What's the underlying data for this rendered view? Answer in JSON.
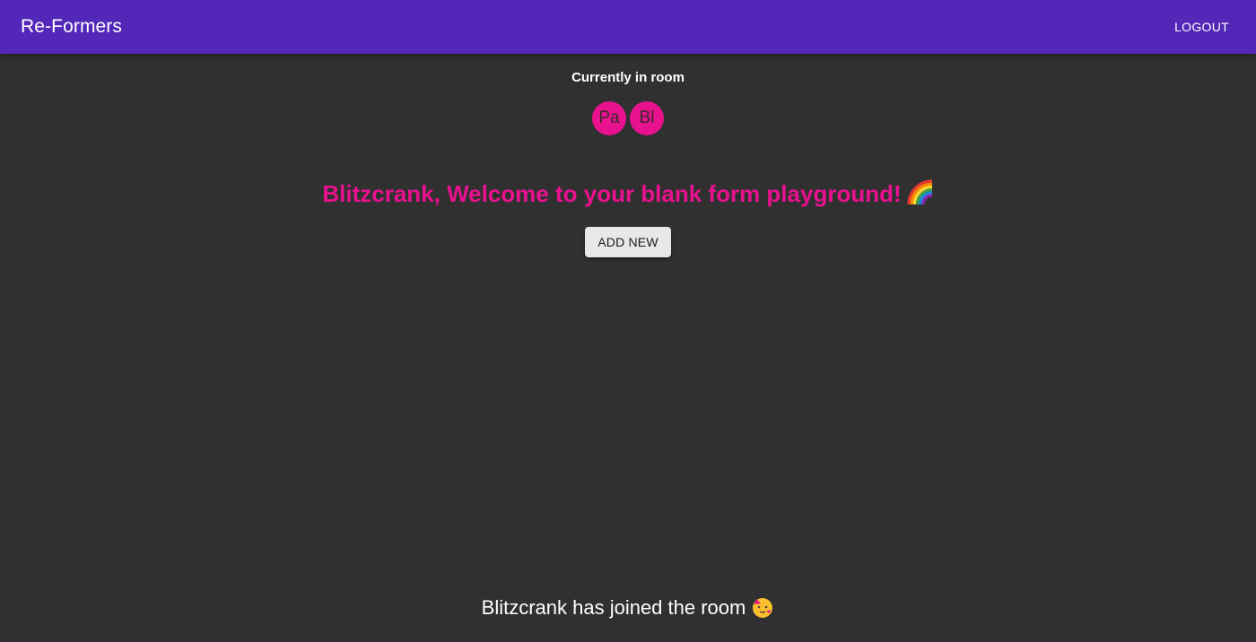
{
  "app_bar": {
    "title": "Re-Formers",
    "logout_label": "LOGOUT",
    "background_color": "#5327b8"
  },
  "room": {
    "heading": "Currently in room",
    "avatars": [
      {
        "initials": "Pa",
        "color": "#e8118e"
      },
      {
        "initials": "Bl",
        "color": "#e8118e"
      }
    ]
  },
  "welcome": {
    "message": "Blitzcrank, Welcome to your blank form playground!",
    "icon": "rainbow-icon",
    "color": "#e8118e"
  },
  "actions": {
    "add_new_label": "ADD NEW"
  },
  "notification": {
    "message": "Blitzcrank has joined the room",
    "icon": "party-face-icon"
  },
  "theme": {
    "background": "#303030",
    "text": "#ffffff"
  }
}
